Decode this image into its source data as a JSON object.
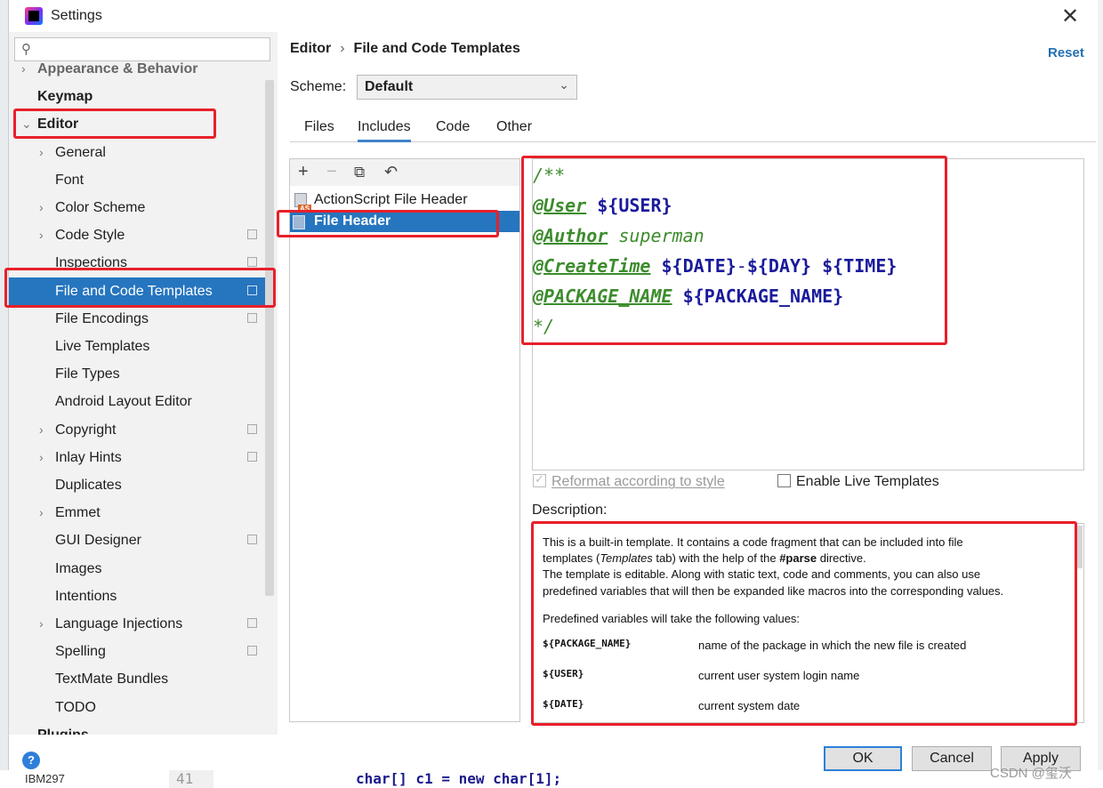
{
  "window": {
    "title": "Settings"
  },
  "search": {
    "placeholder": ""
  },
  "sidebar": {
    "items": [
      {
        "label": "Appearance & Behavior",
        "level": 0,
        "arrow": "›",
        "faded": true
      },
      {
        "label": "Keymap",
        "level": 0,
        "arrow": ""
      },
      {
        "label": "Editor",
        "level": 0,
        "arrow": "⌄"
      },
      {
        "label": "General",
        "level": 1,
        "arrow": "›"
      },
      {
        "label": "Font",
        "level": 1,
        "arrow": ""
      },
      {
        "label": "Color Scheme",
        "level": 1,
        "arrow": "›"
      },
      {
        "label": "Code Style",
        "level": 1,
        "arrow": "›",
        "copy": true
      },
      {
        "label": "Inspections",
        "level": 1,
        "arrow": "",
        "copy": true
      },
      {
        "label": "File and Code Templates",
        "level": 1,
        "arrow": "",
        "copy": true,
        "selected": true
      },
      {
        "label": "File Encodings",
        "level": 1,
        "arrow": "",
        "copy": true
      },
      {
        "label": "Live Templates",
        "level": 1,
        "arrow": ""
      },
      {
        "label": "File Types",
        "level": 1,
        "arrow": ""
      },
      {
        "label": "Android Layout Editor",
        "level": 1,
        "arrow": ""
      },
      {
        "label": "Copyright",
        "level": 1,
        "arrow": "›",
        "copy": true
      },
      {
        "label": "Inlay Hints",
        "level": 1,
        "arrow": "›",
        "copy": true
      },
      {
        "label": "Duplicates",
        "level": 1,
        "arrow": ""
      },
      {
        "label": "Emmet",
        "level": 1,
        "arrow": "›"
      },
      {
        "label": "GUI Designer",
        "level": 1,
        "arrow": "",
        "copy": true
      },
      {
        "label": "Images",
        "level": 1,
        "arrow": ""
      },
      {
        "label": "Intentions",
        "level": 1,
        "arrow": ""
      },
      {
        "label": "Language Injections",
        "level": 1,
        "arrow": "›",
        "copy": true
      },
      {
        "label": "Spelling",
        "level": 1,
        "arrow": "",
        "copy": true
      },
      {
        "label": "TextMate Bundles",
        "level": 1,
        "arrow": ""
      },
      {
        "label": "TODO",
        "level": 1,
        "arrow": ""
      },
      {
        "label": "Plugins",
        "level": 0,
        "arrow": ""
      }
    ]
  },
  "breadcrumb": {
    "parent": "Editor",
    "separator": "›",
    "current": "File and Code Templates"
  },
  "reset_label": "Reset",
  "scheme": {
    "label": "Scheme:",
    "value": "Default"
  },
  "tabs": [
    "Files",
    "Includes",
    "Code",
    "Other"
  ],
  "active_tab": "Includes",
  "templates": [
    {
      "label": "ActionScript File Header",
      "icon_tag": "AS"
    },
    {
      "label": "File Header",
      "selected": true
    }
  ],
  "editor": {
    "line1": "/**",
    "line2_tag": "@User",
    "line2_var": "${USER}",
    "line3_tag": "@Author",
    "line3_text": "superman",
    "line4_tag": "@CreateTime",
    "line4_var1": "${DATE}",
    "line4_dash": "-",
    "line4_var2": "${DAY}",
    "line4_var3": "${TIME}",
    "line5_tag": "@PACKAGE_NAME",
    "line5_var": "${PACKAGE_NAME}",
    "line6": "*/"
  },
  "options": {
    "reformat": "Reformat according to style",
    "live_templates": "Enable Live Templates"
  },
  "description": {
    "label": "Description:",
    "p1a": "This is a built-in template. It contains a code fragment that can be included into file",
    "p1b_pre": "templates (",
    "p1b_em": "Templates",
    "p1b_mid": " tab) with the help of the ",
    "p1b_strong": "#parse",
    "p1b_post": " directive.",
    "p2a": "The template is editable. Along with static text, code and comments, you can also use",
    "p2b": "predefined variables that will then be expanded like macros into the corresponding values.",
    "p3": "Predefined variables will take the following values:",
    "vars": [
      {
        "name": "${PACKAGE_NAME}",
        "desc": "name of the package in which the new file is created"
      },
      {
        "name": "${USER}",
        "desc": "current user system login name"
      },
      {
        "name": "${DATE}",
        "desc": "current system date"
      }
    ]
  },
  "buttons": {
    "ok": "OK",
    "cancel": "Cancel",
    "apply": "Apply"
  },
  "background": {
    "left_text": "IBM297",
    "gutter": "41",
    "code": "char[] c1 = new char[1];"
  },
  "watermark": "CSDN @玺沃",
  "colors": {
    "selection": "#2675bf",
    "accent_link": "#2470b3",
    "annotation_red": "#e8202a",
    "comment_green": "#3c8c2c",
    "var_blue": "#1a1a9c"
  }
}
